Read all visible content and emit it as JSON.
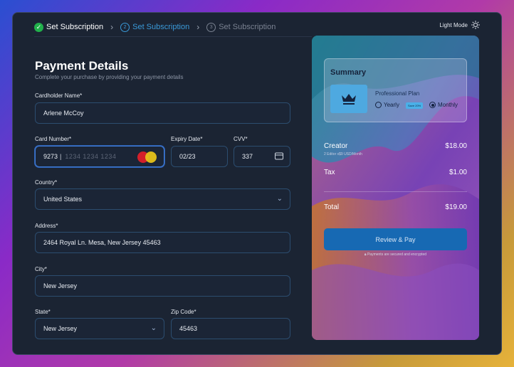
{
  "steps": [
    {
      "num": "",
      "label": "Set Subscription",
      "state": "done"
    },
    {
      "num": "2",
      "label": "Set Subscription",
      "state": "active"
    },
    {
      "num": "3",
      "label": "Set Subscription",
      "state": "todo"
    }
  ],
  "mode_toggle": {
    "label": "Light Mode",
    "icon": "sun-icon"
  },
  "form": {
    "title": "Payment Details",
    "subtitle": "Complete your purchase by providing your payment details",
    "cardholder": {
      "label": "Cardholder Name*",
      "value": "Arlene McCoy"
    },
    "card_number": {
      "label": "Card Number*",
      "value": "9273",
      "placeholder": "1234  1234  1234",
      "brand_icon": "mastercard-icon"
    },
    "expiry": {
      "label": "Expiry Date*",
      "value": "02/23"
    },
    "cvv": {
      "label": "CVV*",
      "value": "337",
      "icon": "credit-card-icon"
    },
    "country": {
      "label": "Country*",
      "value": "United States"
    },
    "address": {
      "label": "Address*",
      "value": "2464 Royal Ln. Mesa, New Jersey 45463"
    },
    "city": {
      "label": "City*",
      "value": "New Jersey"
    },
    "state": {
      "label": "State*",
      "value": "New Jersey"
    },
    "zip": {
      "label": "Zip Code*",
      "value": "45463"
    }
  },
  "summary": {
    "title": "Summary",
    "plan_name": "Professional Plan",
    "plan_icon": "crown-icon",
    "options": [
      {
        "label": "Yearly",
        "selected": false
      },
      {
        "label": "Monthly",
        "selected": true
      }
    ],
    "save_badge": "Save 20%",
    "creator_label": "Creator",
    "creator_detail": "2 Editor x$9 USD/Month",
    "creator_price": "$18.00",
    "tax_label": "Tax",
    "tax_price": "$1.00",
    "total_label": "Total",
    "total_price": "$19.00",
    "pay_button": "Review & Pay",
    "secure_note": "Payments are secured and encrypted"
  },
  "colors": {
    "accent": "#1769b3",
    "active_step": "#3a9ad9",
    "done_step": "#21b04b",
    "panel_bg": "#1b2433"
  }
}
